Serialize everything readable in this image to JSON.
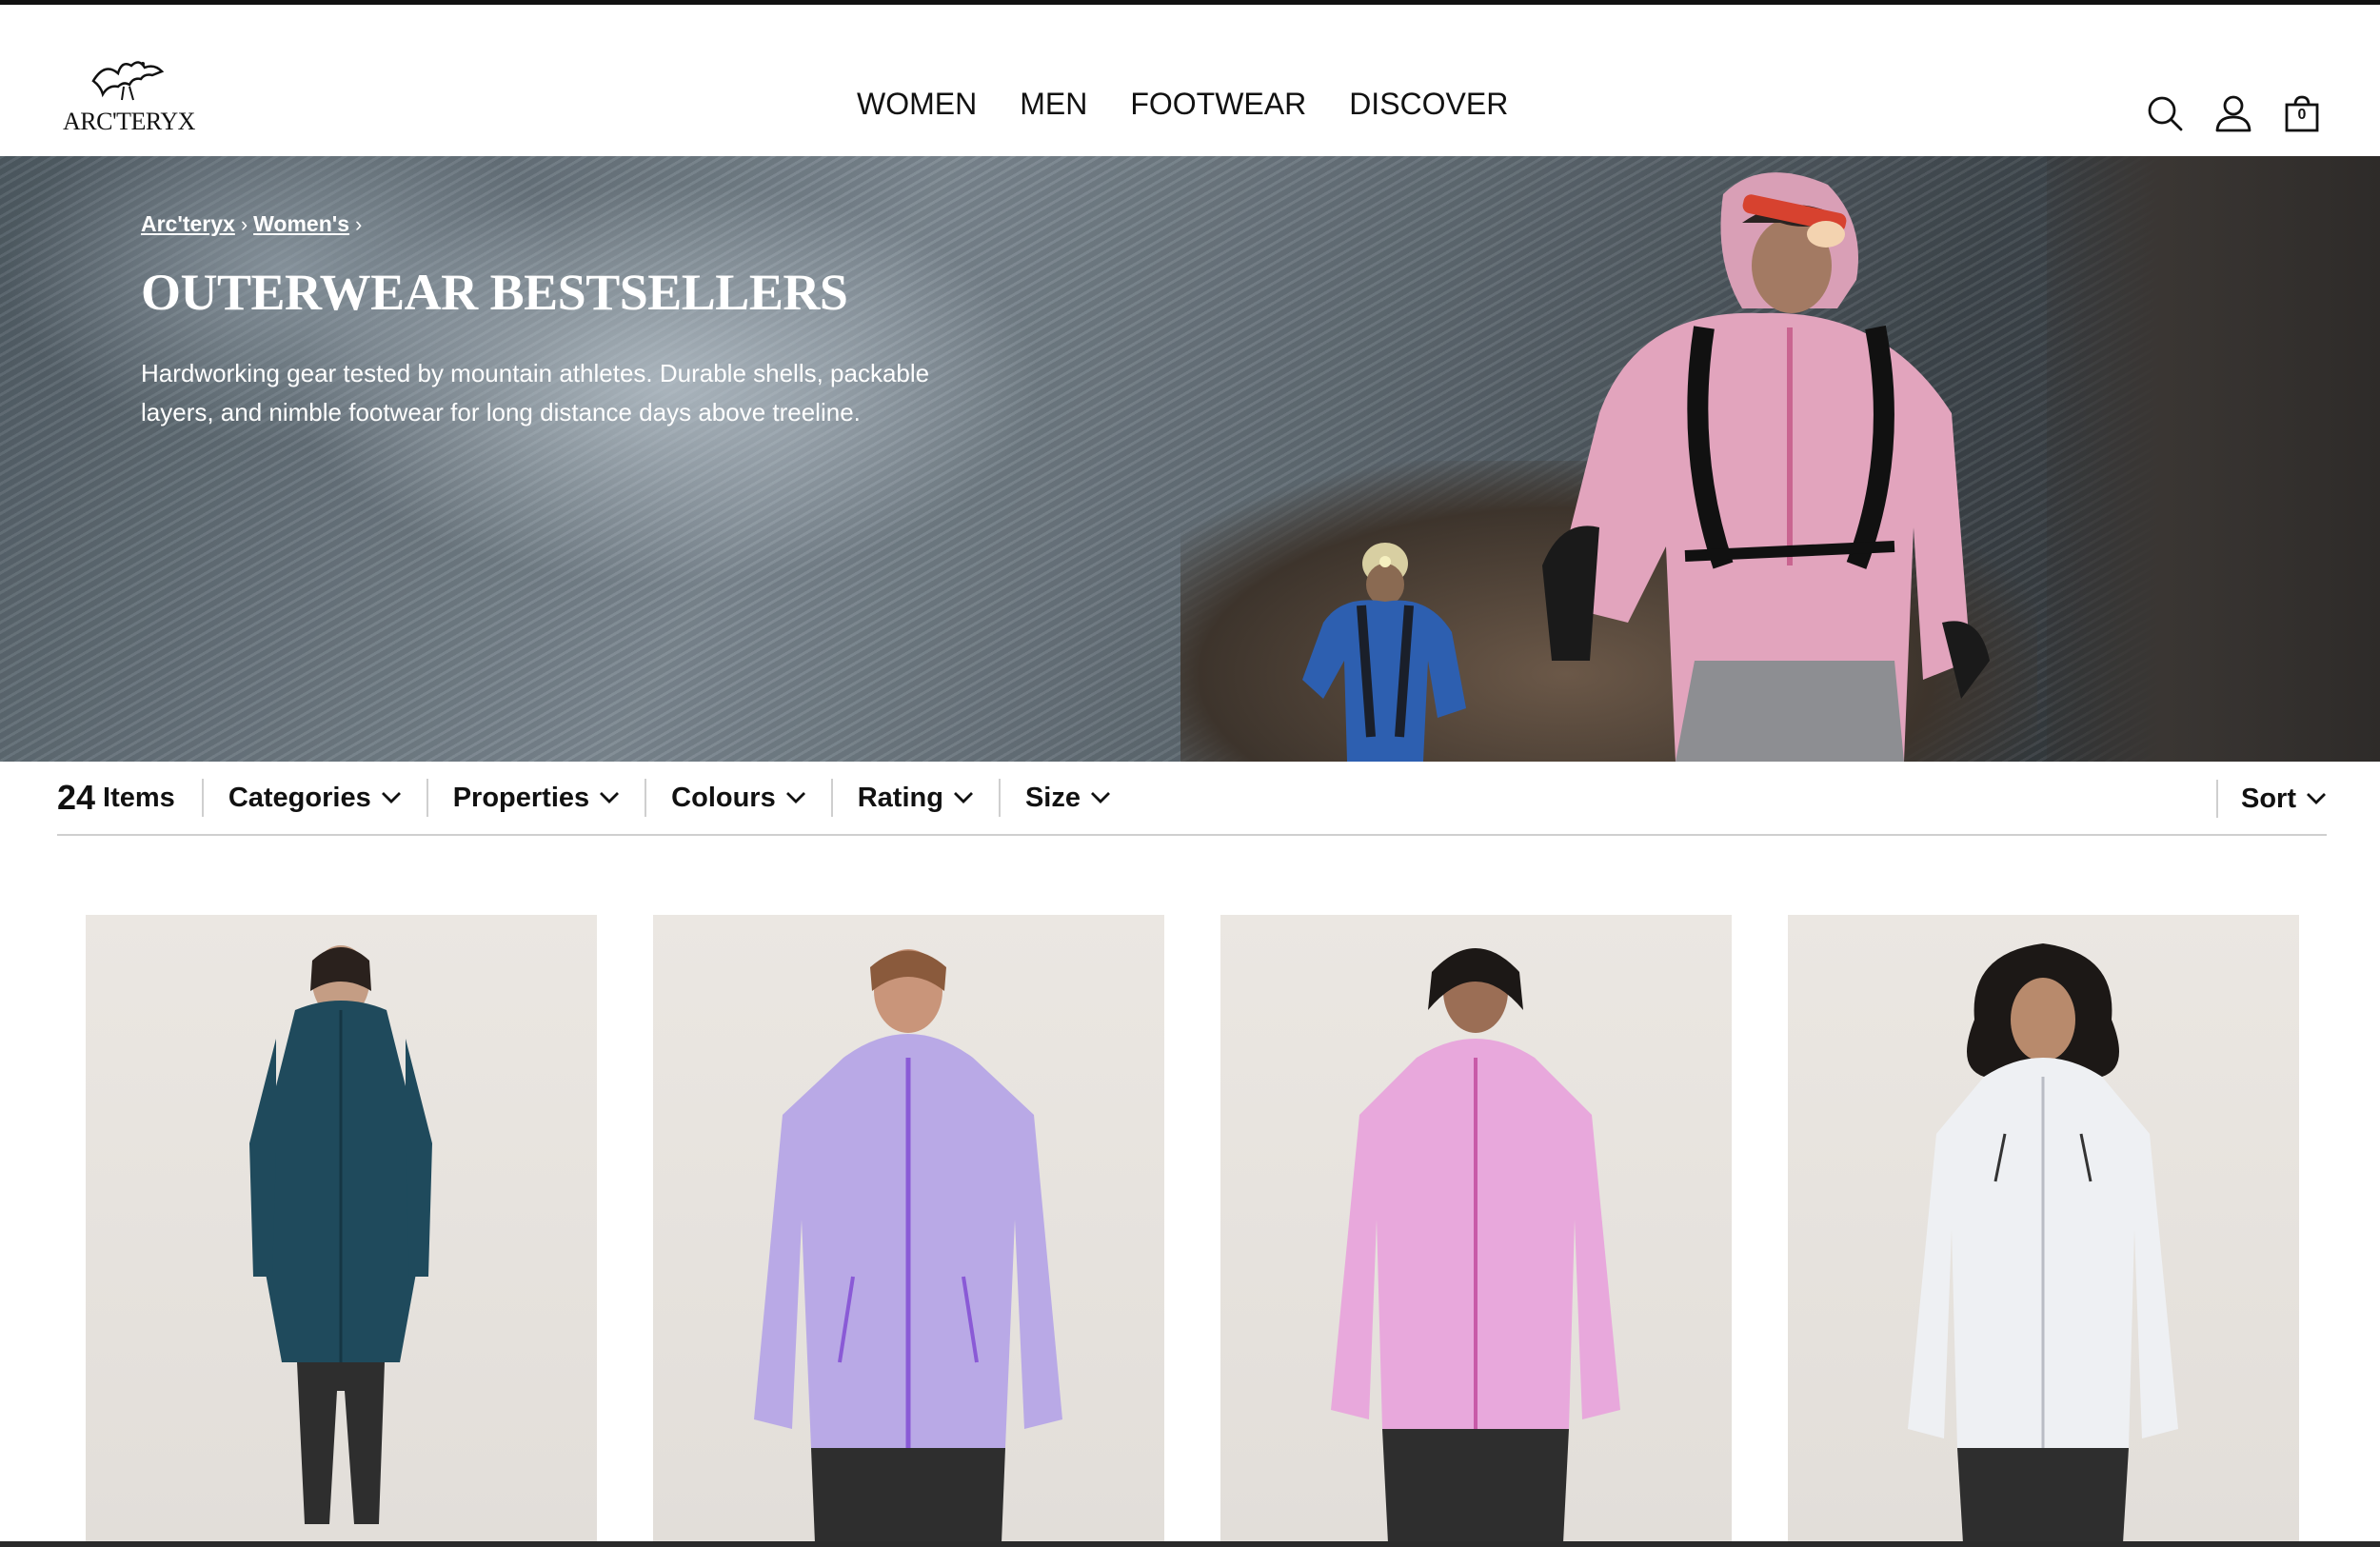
{
  "brand": {
    "logo_text": "ARC'TERYX"
  },
  "nav": {
    "items": [
      "WOMEN",
      "MEN",
      "FOOTWEAR",
      "DISCOVER"
    ]
  },
  "header_icons": {
    "search": "search-icon",
    "account": "account-icon",
    "cart": "bag-icon",
    "cart_count": "0"
  },
  "hero": {
    "breadcrumb": [
      "Arc'teryx",
      "Women's"
    ],
    "title": "OUTERWEAR BESTSELLERS",
    "description": "Hardworking gear tested by mountain athletes. Durable shells, packable layers, and nimble footwear for long distance days above treeline."
  },
  "filters": {
    "count": "24",
    "count_label": "Items",
    "items": [
      "Categories",
      "Properties",
      "Colours",
      "Rating",
      "Size"
    ],
    "sort_label": "Sort"
  },
  "products": [
    {
      "colour": "#1f4a5c"
    },
    {
      "colour": "#b9a9e6"
    },
    {
      "colour": "#e8a8dc"
    },
    {
      "colour": "#eef0f3"
    }
  ]
}
